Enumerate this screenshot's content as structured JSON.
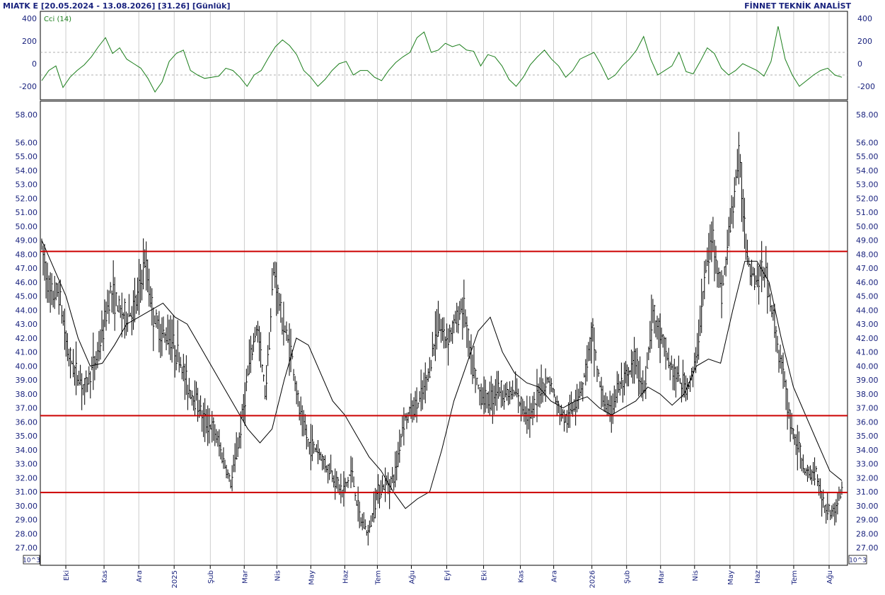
{
  "header": {
    "title": "MIATK E  [20.05.2024 - 13.08.2026]  [31.26]  [Günlük]",
    "brand": "FİNNET TEKNİK ANALİST"
  },
  "colors": {
    "axis_text": "#1a237e",
    "cci_line": "#1b7e1b",
    "price_bars": "#000000",
    "sma_line": "#000000",
    "levels": "#cc0000",
    "grid": "#aaaaaa"
  },
  "chart_data": [
    {
      "type": "line",
      "name": "cci-panel",
      "legend": "Cci (14)",
      "ylim": [
        -300,
        450
      ],
      "yticks": [
        400,
        200,
        0,
        -200
      ],
      "reference_lines": [
        100,
        -100
      ],
      "grid": true,
      "x_range": [
        0,
        1130
      ],
      "x": [
        0,
        10,
        20,
        30,
        40,
        50,
        60,
        70,
        80,
        90,
        100,
        110,
        120,
        130,
        140,
        150,
        160,
        170,
        180,
        190,
        200,
        210,
        220,
        230,
        240,
        250,
        260,
        270,
        280,
        290,
        300,
        310,
        320,
        330,
        340,
        350,
        360,
        370,
        380,
        390,
        400,
        410,
        420,
        430,
        440,
        450,
        460,
        470,
        480,
        490,
        500,
        510,
        520,
        530,
        540,
        550,
        560,
        570,
        580,
        590,
        600,
        610,
        620,
        630,
        640,
        650,
        660,
        670,
        680,
        690,
        700,
        710,
        720,
        730,
        740,
        750,
        760,
        770,
        780,
        790,
        800,
        810,
        820,
        830,
        840,
        850,
        860,
        870,
        880,
        890,
        900,
        910,
        920,
        930,
        940,
        950,
        960,
        970,
        980,
        990,
        1000,
        1010,
        1020,
        1030,
        1040,
        1050,
        1060,
        1070,
        1080,
        1090,
        1100,
        1110,
        1120,
        1130
      ],
      "values": [
        -150,
        -60,
        -20,
        -210,
        -120,
        -60,
        -10,
        60,
        150,
        230,
        90,
        140,
        40,
        0,
        -40,
        -130,
        -250,
        -160,
        20,
        90,
        120,
        -60,
        -100,
        -130,
        -120,
        -110,
        -40,
        -60,
        -120,
        -200,
        -100,
        -60,
        50,
        150,
        210,
        160,
        80,
        -60,
        -120,
        -200,
        -140,
        -60,
        0,
        20,
        -100,
        -60,
        -60,
        -120,
        -150,
        -60,
        10,
        60,
        100,
        230,
        280,
        100,
        120,
        180,
        150,
        170,
        120,
        110,
        -20,
        80,
        60,
        -20,
        -140,
        -200,
        -120,
        -10,
        60,
        120,
        40,
        -20,
        -120,
        -60,
        40,
        70,
        100,
        -10,
        -140,
        -100,
        -20,
        40,
        120,
        240,
        40,
        -100,
        -60,
        -20,
        100,
        -70,
        -90,
        20,
        140,
        90,
        -40,
        -100,
        -60,
        0,
        -30,
        -60,
        -110,
        20,
        330,
        40,
        -100,
        -200,
        -150,
        -100,
        -60,
        -40,
        -100,
        -120
      ]
    },
    {
      "type": "bar",
      "name": "price-panel",
      "series_note": "daily OHLC bars with moving average and horizontal levels",
      "ylim": [
        26.5,
        58.5
      ],
      "yticks": [
        58,
        56,
        55,
        54,
        53,
        52,
        51,
        50,
        49,
        48,
        47,
        46,
        45,
        44,
        43,
        42,
        41,
        40,
        39,
        38,
        37,
        36,
        35,
        34,
        33,
        32,
        31,
        30,
        29,
        28,
        27
      ],
      "ytick_labels": [
        "58.00",
        "56.00",
        "55.00",
        "54.00",
        "53.00",
        "52.00",
        "51.00",
        "50.00",
        "49.00",
        "48.00",
        "47.00",
        "46.00",
        "45.00",
        "44.00",
        "43.00",
        "42.00",
        "41.00",
        "40.00",
        "39.00",
        "38.00",
        "37.00",
        "36.00",
        "35.00",
        "34.00",
        "33.00",
        "32.00",
        "31.00",
        "30.00",
        "29.00",
        "28.00",
        "27.00"
      ],
      "unit_label": "10^3",
      "levels": [
        48.2,
        36.45,
        30.95
      ],
      "x_range": [
        0,
        1130
      ],
      "xticks": [
        {
          "label": "Eki",
          "x": 34
        },
        {
          "label": "Kas",
          "x": 88
        },
        {
          "label": "Ara",
          "x": 137
        },
        {
          "label": "2025",
          "x": 187
        },
        {
          "label": "Şub",
          "x": 238
        },
        {
          "label": "Mar",
          "x": 286
        },
        {
          "label": "Nis",
          "x": 332
        },
        {
          "label": "May",
          "x": 380
        },
        {
          "label": "Haz",
          "x": 428
        },
        {
          "label": "Tem",
          "x": 474
        },
        {
          "label": "Ağu",
          "x": 522
        },
        {
          "label": "Eyl",
          "x": 572
        },
        {
          "label": "Eki",
          "x": 624
        },
        {
          "label": "Kas",
          "x": 676
        },
        {
          "label": "Ara",
          "x": 723
        },
        {
          "label": "2026",
          "x": 777
        },
        {
          "label": "Şub",
          "x": 826
        },
        {
          "label": "Mar",
          "x": 874
        },
        {
          "label": "Nis",
          "x": 922
        },
        {
          "label": "May",
          "x": 972
        },
        {
          "label": "Haz",
          "x": 1010
        },
        {
          "label": "Tem",
          "x": 1062
        },
        {
          "label": "Ağu",
          "x": 1112
        }
      ],
      "x": [
        0,
        10,
        20,
        30,
        40,
        50,
        60,
        70,
        80,
        90,
        100,
        110,
        120,
        130,
        140,
        150,
        160,
        170,
        180,
        190,
        200,
        210,
        220,
        230,
        240,
        250,
        260,
        270,
        280,
        290,
        300,
        310,
        320,
        330,
        340,
        350,
        360,
        370,
        380,
        390,
        400,
        410,
        420,
        430,
        440,
        450,
        460,
        470,
        480,
        490,
        500,
        510,
        520,
        530,
        540,
        550,
        560,
        570,
        580,
        590,
        600,
        610,
        620,
        630,
        640,
        650,
        660,
        670,
        680,
        690,
        700,
        710,
        720,
        730,
        740,
        750,
        760,
        770,
        780,
        790,
        800,
        810,
        820,
        830,
        840,
        850,
        860,
        870,
        880,
        890,
        900,
        910,
        920,
        930,
        940,
        950,
        960,
        970,
        980,
        990,
        1000,
        1010,
        1020,
        1030,
        1040,
        1050,
        1060,
        1070,
        1080,
        1090,
        1100,
        1110,
        1120,
        1130
      ],
      "close": [
        48.5,
        45.0,
        45.3,
        41.0,
        39.5,
        38.5,
        40.0,
        42.0,
        45.5,
        44.0,
        43.5,
        44.5,
        47.5,
        43.5,
        42.2,
        42.0,
        40.5,
        38.5,
        37.5,
        36.0,
        35.5,
        33.5,
        31.5,
        35.0,
        39.5,
        43.0,
        38.0,
        47.0,
        43.0,
        41.0,
        36.5,
        34.5,
        34.0,
        33.0,
        32.0,
        31.0,
        32.5,
        29.0,
        28.0,
        31.0,
        31.5,
        32.0,
        36.0,
        36.8,
        37.5,
        39.5,
        43.0,
        42.0,
        43.0,
        44.5,
        40.0,
        38.0,
        37.5,
        38.5,
        38.0,
        38.0,
        37.0,
        36.5,
        38.5,
        39.0,
        37.0,
        36.0,
        37.5,
        39.0,
        42.5,
        38.0,
        36.5,
        38.5,
        39.0,
        40.5,
        38.0,
        44.0,
        42.0,
        40.0,
        39.0,
        38.5,
        40.0,
        46.0,
        49.5,
        45.0,
        50.0,
        55.0,
        48.0,
        46.0,
        47.0,
        43.5,
        40.0,
        36.0,
        34.0,
        32.0,
        32.5,
        30.0,
        29.5,
        31.2
      ],
      "sma": [
        49.0,
        47.0,
        45.0,
        42.0,
        40.0,
        40.2,
        41.5,
        43.0,
        43.5,
        44.0,
        44.5,
        43.5,
        43.0,
        41.5,
        40.0,
        38.5,
        37.0,
        35.5,
        34.5,
        35.5,
        39.0,
        42.0,
        41.5,
        39.5,
        37.5,
        36.5,
        35.0,
        33.5,
        32.5,
        31.0,
        29.8,
        30.5,
        31.0,
        34.0,
        37.5,
        40.0,
        42.5,
        43.5,
        41.0,
        39.5,
        38.8,
        38.5,
        37.5,
        37.0,
        37.5,
        37.8,
        37.0,
        36.5,
        37.0,
        37.5,
        38.5,
        38.0,
        37.2,
        38.0,
        40.0,
        40.5,
        40.2,
        44.0,
        47.5,
        47.5,
        46.0,
        42.0,
        38.5,
        36.5,
        34.5,
        32.5,
        31.8
      ]
    }
  ]
}
